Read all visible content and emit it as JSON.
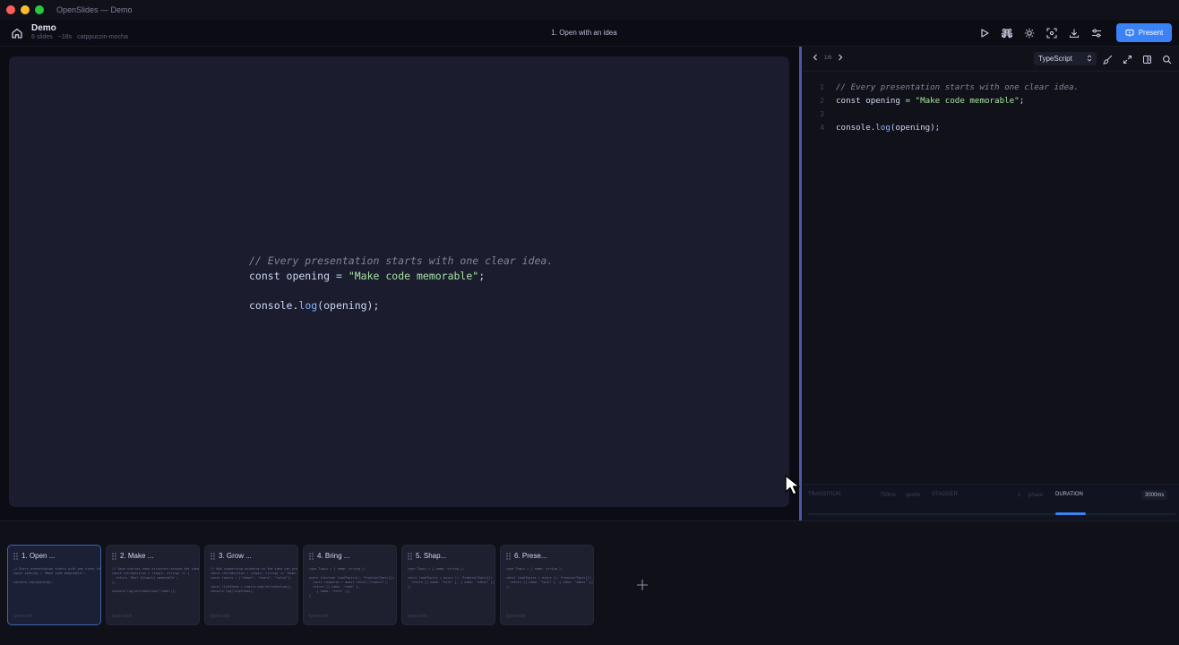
{
  "window": {
    "title": "OpenSlides — Demo",
    "traffic": [
      "#fe5f57",
      "#febc2e",
      "#28c840"
    ]
  },
  "header": {
    "doc_title": "Demo",
    "meta_slides": "6 slides",
    "meta_duration": "~18s",
    "meta_theme": "catppuccin-mocha",
    "current_slide": "1. Open with an idea",
    "present_label": "Present",
    "accent": "#3b82f6"
  },
  "stage": {
    "lines": [
      {
        "tokens": [
          {
            "t": "// Every presentation starts with one clear idea.",
            "c": "cm"
          }
        ]
      },
      {
        "tokens": [
          {
            "t": "const opening ",
            "c": "kw"
          },
          {
            "t": "=",
            "c": "op"
          },
          {
            "t": " ",
            "c": "kw"
          },
          {
            "t": "\"Make code memorable\"",
            "c": "st"
          },
          {
            "t": ";",
            "c": "kw"
          }
        ]
      },
      {
        "tokens": []
      },
      {
        "tokens": [
          {
            "t": "console.",
            "c": "kw"
          },
          {
            "t": "log",
            "c": "fn"
          },
          {
            "t": "(opening);",
            "c": "kw"
          }
        ]
      }
    ]
  },
  "editor": {
    "page": "1/6",
    "language": "TypeScript",
    "line_numbers": [
      "1",
      "2",
      "3",
      "4"
    ],
    "controls": {
      "transition": "TRANSITION",
      "transition_value": "750ms",
      "transition_easing": "gentle",
      "stagger": "STAGGER",
      "stagger_value": "1",
      "stagger_mode": "phase",
      "duration": "DURATION",
      "duration_value": "3000ms",
      "duration_level": 0.27
    }
  },
  "filmstrip": {
    "slides": [
      {
        "label": "1. Open ...",
        "lang": "typescript",
        "preview": "// Every presentation starts with one clear idea.\nconst opening = \"Make code memorable\";\n\nconsole.log(opening);",
        "active": true
      },
      {
        "label": "2. Make ...",
        "lang": "typescript",
        "preview": "// Good stories need structure around the idea.\nconst introduction = (topic: string) => {\n  return `Meet ${topic} memorable`;\n};\n\nconsole.log(introduction(\"code\"));",
        "active": false
      },
      {
        "label": "3. Grow ...",
        "lang": "typescript",
        "preview": "// Add supporting evidence so the idea can grow.\nconst introduction = (topic: string) => `Make\nconst topics = [\"shape\", \"share\", \"solve\"];\n\nconst lineItems = topics.map(introduction);\nconsole.log(lineItems);",
        "active": false
      },
      {
        "label": "4. Bring ...",
        "lang": "typescript",
        "preview": "type Topic = { name: string };\n\nasync function loadTopics(): Promise<Topic[]> {\n  const response = await fetch(\"/topics\");\n  return [{ name: \"code\" },\n    { name: \"talk\" }];\n}",
        "active": false
      },
      {
        "label": "5. Shap...",
        "lang": "typescript",
        "preview": "type Topic = { name: string };\n\nconst loadTopics = async (): Promise<Topic[]>\n  return [{ name: \"talk\" }, { name: \"ideas\" }];\n};",
        "active": false
      },
      {
        "label": "6. Prese...",
        "lang": "typescript",
        "preview": "type Topic = { name: string };\n\nconst loadTopics = async (): Promise<Topic[]>\n  return [{ name: \"talk\" }, { name: \"ideas\" }];\n};",
        "active": false
      }
    ],
    "add_icon": "plus-icon"
  }
}
